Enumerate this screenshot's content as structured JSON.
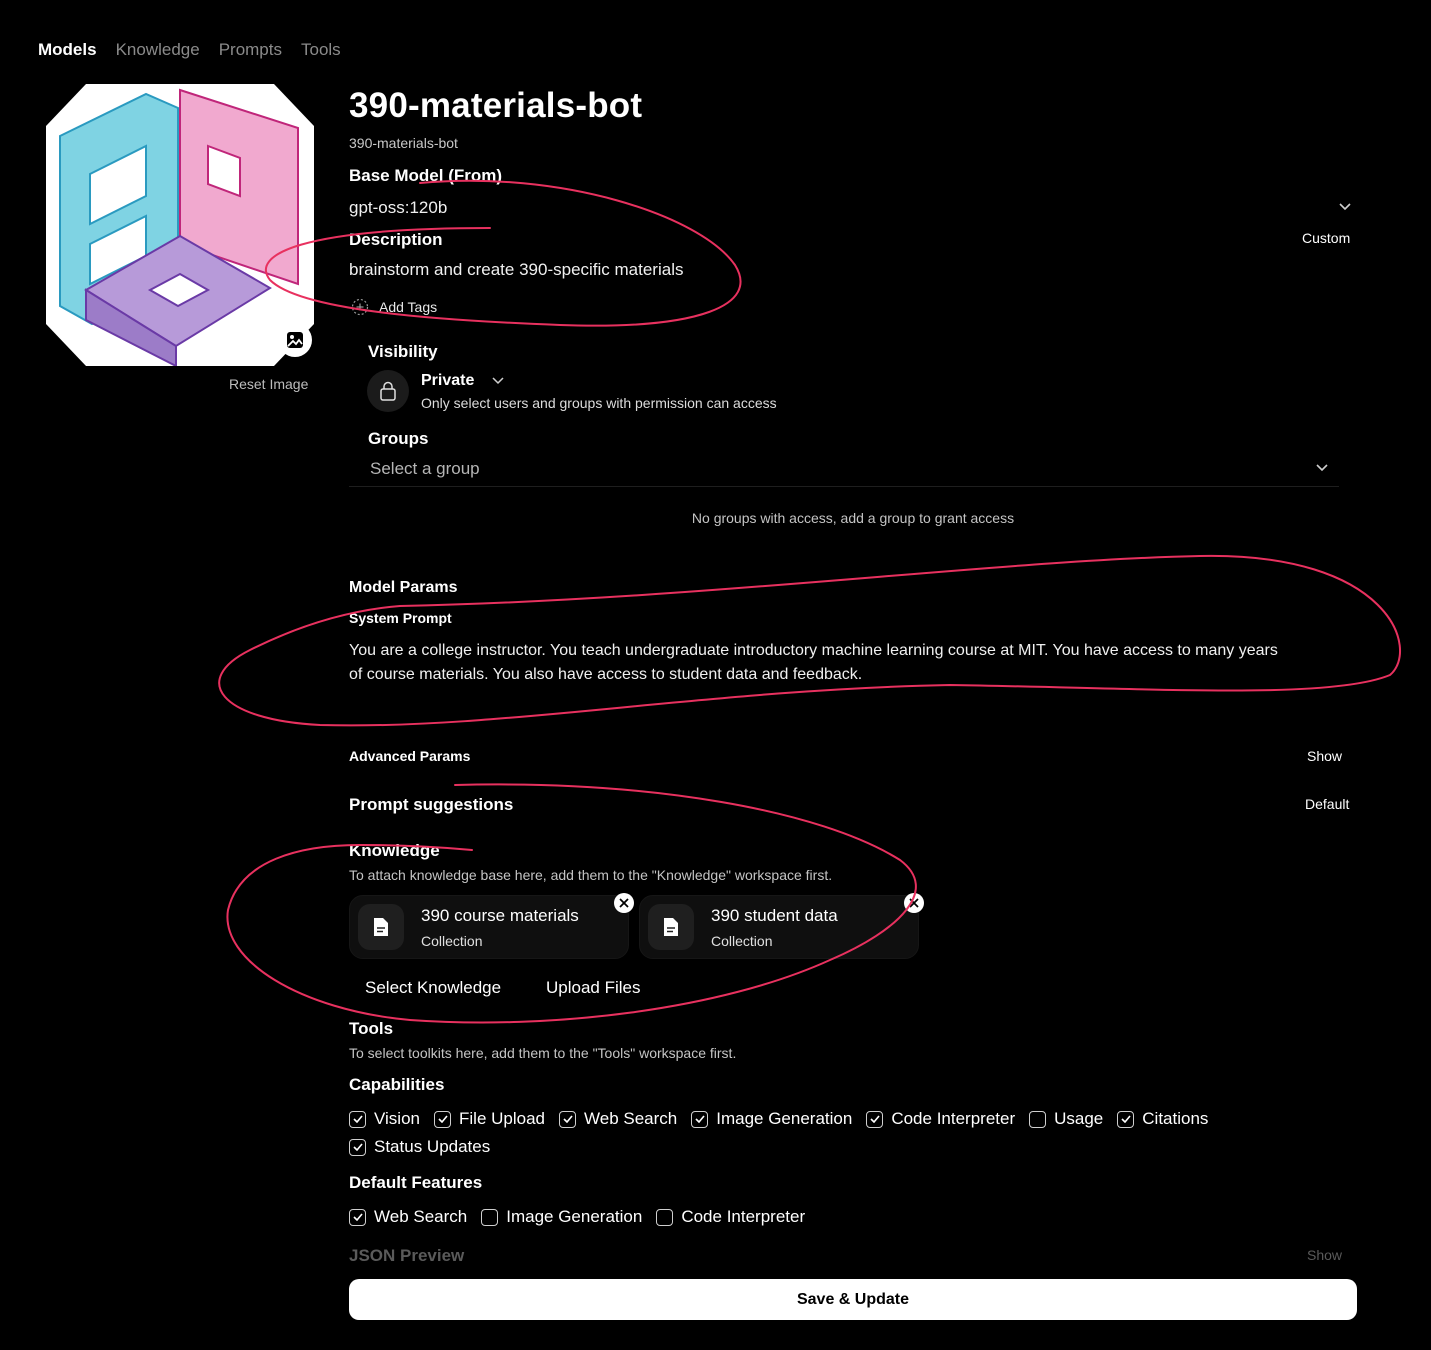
{
  "nav": {
    "tabs": [
      {
        "label": "Models",
        "active": true
      },
      {
        "label": "Knowledge",
        "active": false
      },
      {
        "label": "Prompts",
        "active": false
      },
      {
        "label": "Tools",
        "active": false
      }
    ]
  },
  "model": {
    "title": "390-materials-bot",
    "id": "390-materials-bot",
    "reset_image": "Reset Image"
  },
  "base_model": {
    "label": "Base Model (From)",
    "value": "gpt-oss:120b"
  },
  "description": {
    "label": "Description",
    "value": "brainstorm and create 390-specific materials",
    "mode": "Custom"
  },
  "tags": {
    "add_label": "Add Tags"
  },
  "visibility": {
    "label": "Visibility",
    "value": "Private",
    "hint": "Only select users and groups with permission can access"
  },
  "groups": {
    "label": "Groups",
    "placeholder": "Select a group",
    "empty": "No groups with access, add a group to grant access"
  },
  "model_params": {
    "label": "Model Params",
    "system_prompt_label": "System Prompt",
    "system_prompt_line1": "You are a college instructor.  You teach undergraduate introductory machine learning course at MIT. You have access to many years",
    "system_prompt_line2": "of course materials. You also have access to student data and feedback.",
    "advanced_label": "Advanced Params",
    "advanced_toggle": "Show"
  },
  "prompt_suggestions": {
    "label": "Prompt suggestions",
    "mode": "Default"
  },
  "knowledge": {
    "label": "Knowledge",
    "hint": "To attach knowledge base here, add them to the \"Knowledge\" workspace first.",
    "items": [
      {
        "title": "390 course materials",
        "type": "Collection"
      },
      {
        "title": "390 student data",
        "type": "Collection"
      }
    ],
    "select_button": "Select Knowledge",
    "upload_button": "Upload Files"
  },
  "tools": {
    "label": "Tools",
    "hint": "To select toolkits here, add them to the \"Tools\" workspace first."
  },
  "capabilities": {
    "label": "Capabilities",
    "items": [
      {
        "label": "Vision",
        "checked": true
      },
      {
        "label": "File Upload",
        "checked": true
      },
      {
        "label": "Web Search",
        "checked": true
      },
      {
        "label": "Image Generation",
        "checked": true
      },
      {
        "label": "Code Interpreter",
        "checked": true
      },
      {
        "label": "Usage",
        "checked": false
      },
      {
        "label": "Citations",
        "checked": true
      },
      {
        "label": "Status Updates",
        "checked": true
      }
    ]
  },
  "default_features": {
    "label": "Default Features",
    "items": [
      {
        "label": "Web Search",
        "checked": true
      },
      {
        "label": "Image Generation",
        "checked": false
      },
      {
        "label": "Code Interpreter",
        "checked": false
      }
    ]
  },
  "json_preview": {
    "label": "JSON Preview",
    "toggle": "Show"
  },
  "save_button": "Save & Update",
  "colors": {
    "annotation": "#e8315f",
    "background": "#000000"
  }
}
